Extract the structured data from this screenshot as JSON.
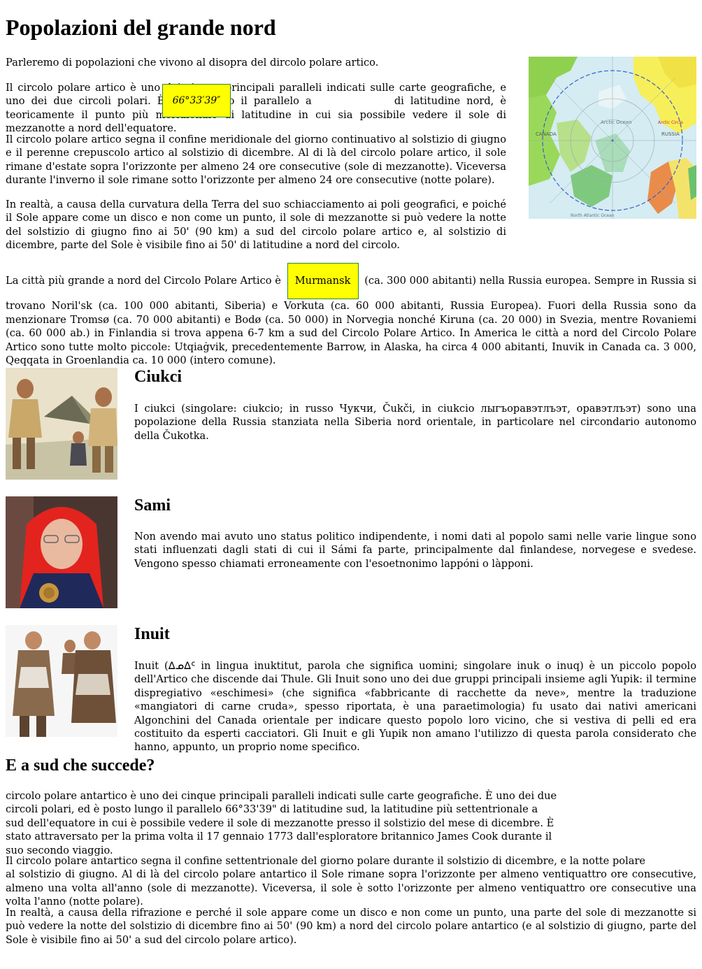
{
  "title": "Popolazioni del grande nord",
  "intro": "Parleremo di popolazioni che vivono al disopra del dircolo polare artico.",
  "p1": {
    "before": "Il circolo polare artico è uno dei cinque principali paralleli indicati sulle carte geografiche, e uno dei due circoli polari. È posto lungo il parallelo a",
    "highlight": "66°33′39″",
    "after": "di latitudine nord, è teoricamente il punto più meridionale di latitudine in cui sia possibile vedere il sole di mezzanotte a nord dell'equatore."
  },
  "p2": "Il circolo polare artico segna il confine meridionale del giorno continuativo al solstizio di giugno e il perenne crepuscolo artico al solstizio di dicembre. Al di là del circolo polare artico, il sole rimane d'estate sopra l'orizzonte per almeno 24 ore consecutive (sole di mezzanotte). Viceversa durante l'inverno il sole rimane sotto l'orizzonte per almeno 24 ore consecutive (notte polare).",
  "p3": "In realtà, a causa della curvatura della Terra del suo schiacciamento ai poli geografici, e poiché il Sole appare come un disco e non come un punto, il sole di mezzanotte si può vedere la notte del solstizio di giugno fino ai 50' (90 km) a sud del circolo polare artico e, al solstizio di dicembre, parte del Sole è visibile fino ai 50' di latitudine a nord del circolo.",
  "map": {
    "labels": [
      "Arctic Ocean",
      "CANADA",
      "RUSSIA",
      "North Atlantic Ocean",
      "Arctic Circle"
    ]
  },
  "cities": {
    "before": "La città più grande a nord del Circolo Polare Artico è",
    "highlight": "Murmansk",
    "after": "(ca. 300 000 abitanti) nella Russia europea. Sempre in Russia si trovano Noril'sk (ca. 100 000 abitanti, Siberia) e Vorkuta (ca. 60 000 abitanti, Russia Europea). Fuori della Russia sono da menzionare Tromsø (ca. 70 000 abitanti) e Bodø (ca. 50 000) in Norvegia nonché Kiruna (ca. 20 000) in Svezia, mentre Rovaniemi (ca. 60 000 ab.) in Finlandia si trova appena 6-7 km a sud del Circolo Polare Artico. In America le città a nord del Circolo Polare Artico sono tutte molto piccole: Utqiaġvik, precedentemente Barrow, in Alaska, ha circa 4 000 abitanti, Inuvik in Canada ca. 3 000, Qeqqata in Groenlandia ca. 10 000 (intero comune)."
  },
  "sections": [
    {
      "heading": "Ciukci",
      "text": "I ciukci (singolare: ciukcio; in russo Чукчи, Čukči, in ciukcio лыгъоравэтлъэт, оравэтлъэт) sono una popolazione della Russia stanziata nella Siberia nord orientale, in particolare nel circondario autonomo della Čukotka."
    },
    {
      "heading": "Sami",
      "text": "Non avendo mai avuto uno status politico indipendente, i nomi dati al popolo sami nelle varie lingue sono stati influenzati dagli stati di cui il Sámi fa parte, principalmente dal finlandese, norvegese e svedese. Vengono spesso chiamati erroneamente con l'esoetnonimo lappóni o làpponi."
    },
    {
      "heading": "Inuit",
      "text": "Inuit (ᐃᓄᐃᑦ in lingua inuktitut, parola che significa uomini; singolare inuk o inuq) è un piccolo popolo dell'Artico che discende dai Thule. Gli Inuit sono uno dei due gruppi principali insieme agli Yupik: il termine dispregiativo «eschimesi» (che significa «fabbricante di racchette da neve», mentre la traduzione «mangiatori di carne cruda», spesso riportata, è una paraetimologia) fu usato dai nativi americani Algonchini del Canada orientale per indicare questo popolo loro vicino, che si vestiva di pelli ed era costituito da esperti cacciatori. Gli Inuit e gli Yupik non amano l'utilizzo di questa parola considerato che hanno, appunto, un proprio nome specifico."
    }
  ],
  "south": {
    "heading": "E a sud che succede?",
    "p1": "circolo polare antartico è uno dei cinque principali paralleli indicati sulle carte geografiche. È uno dei due circoli polari, ed è posto lungo il parallelo 66°33'39\" di latitudine sud, la latitudine più settentrionale a sud dell'equatore in cui è possibile vedere il sole di mezzanotte presso il solstizio del mese di dicembre. È stato attraversato per la prima volta il 17 gennaio 1773 dall'esploratore britannico James Cook durante il suo secondo viaggio.",
    "p2_line1": "Il circolo polare antartico segna il confine settentrionale del giorno polare durante il solstizio di dicembre, e la notte polare",
    "p2_rest": "al solstizio di giugno. Al di là del circolo polare antartico il Sole rimane sopra l'orizzonte per almeno ventiquattro ore consecutive, almeno una volta all'anno (sole di mezzanotte). Viceversa, il sole è sotto l'orizzonte per almeno ventiquattro ore consecutive una volta l'anno (notte polare).",
    "p3": "In realtà, a causa della rifrazione e perché il sole appare come un disco e non come un punto, una parte del sole di mezzanotte si può vedere la notte del solstizio di dicembre fino ai 50' (90 km) a nord del circolo polare antartico (e al solstizio di giugno, parte del Sole è visibile fino ai 50' a sud del circolo polare artico)."
  }
}
